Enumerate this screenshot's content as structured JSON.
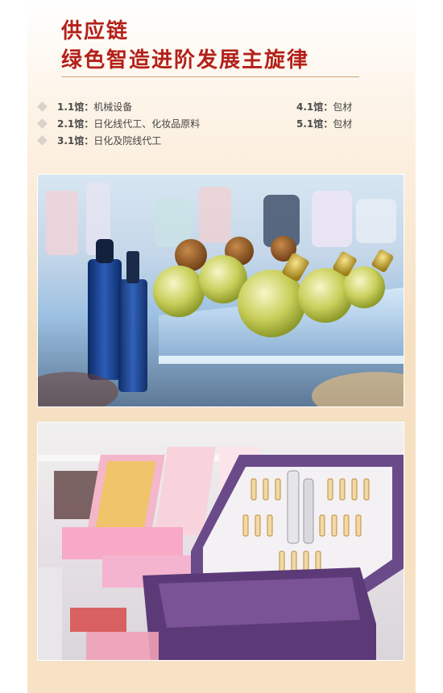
{
  "header": {
    "title_line1": "供应链",
    "title_line2": "绿色智造进阶发展主旋律"
  },
  "halls": [
    {
      "code": "1.1馆",
      "sep": "：",
      "desc": "机械设备"
    },
    {
      "code": "2.1馆",
      "sep": "：",
      "desc": "日化线代工、化妆品原料"
    },
    {
      "code": "3.1馆",
      "sep": "：",
      "desc": "日化及院线代工"
    },
    {
      "code": "4.1馆",
      "sep": "：",
      "desc": "包材"
    },
    {
      "code": "5.1馆",
      "sep": "：",
      "desc": "包材"
    }
  ],
  "colors": {
    "title": "#b3211a",
    "panel_top": "#fdf3e6",
    "panel_bottom": "#f7e2c6",
    "diamond": "#d9d2ca",
    "box_purple": "#6b4a8a",
    "box_pink": "#f2a7c3"
  },
  "images": [
    {
      "name": "perfume-bottles-photo"
    },
    {
      "name": "cosmetics-gift-box-photo"
    }
  ]
}
